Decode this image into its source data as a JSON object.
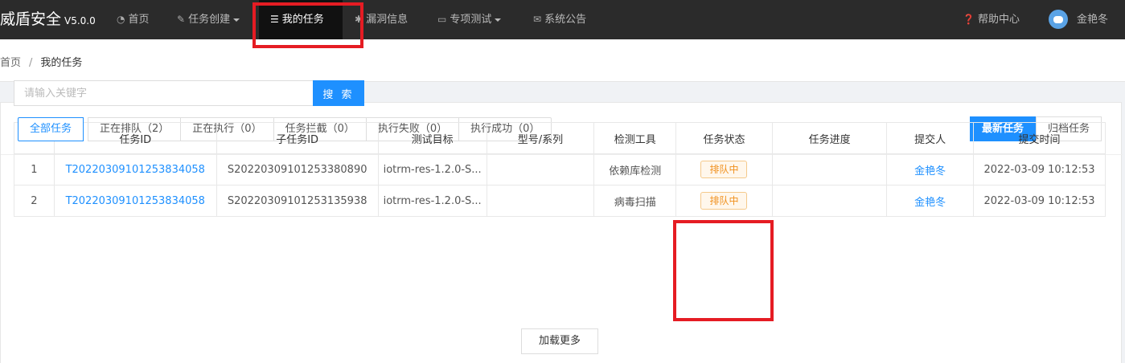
{
  "brand": {
    "name": "威盾安全",
    "version": "V5.0.0"
  },
  "nav": [
    {
      "label": "首页",
      "icon": "dashboard-icon"
    },
    {
      "label": "任务创建",
      "icon": "edit-icon",
      "dropdown": true
    },
    {
      "label": "我的任务",
      "icon": "list-icon",
      "active": true
    },
    {
      "label": "漏洞信息",
      "icon": "bug-icon"
    },
    {
      "label": "专项测试",
      "icon": "monitor-icon",
      "dropdown": true
    },
    {
      "label": "系统公告",
      "icon": "mail-icon"
    }
  ],
  "user_nav": {
    "help": "帮助中心",
    "username": "金艳冬"
  },
  "breadcrumb": {
    "home": "首页",
    "separator": "/",
    "current": "我的任务"
  },
  "status_tabs": [
    "全部任务",
    "正在排队（2）",
    "正在执行（0）",
    "任务拦截（0）",
    "执行失败（0）",
    "执行成功（0）"
  ],
  "view_tabs": [
    "最新任务",
    "归档任务"
  ],
  "search": {
    "placeholder": "请输入关键字",
    "button": "搜 索"
  },
  "table": {
    "headers": [
      "",
      "任务ID",
      "子任务ID",
      "测试目标",
      "型号/系列",
      "检测工具",
      "任务状态",
      "任务进度",
      "提交人",
      "提交时间"
    ],
    "rows": [
      {
        "index": "1",
        "task_id": "T20220309101253834058",
        "subtask_id": "S20220309101253380890",
        "target": "iotrm-res-1.2.0-S...",
        "model": "",
        "tool": "依赖库检测",
        "status": "排队中",
        "progress": "",
        "submitter": "金艳冬",
        "time": "2022-03-09 10:12:53"
      },
      {
        "index": "2",
        "task_id": "T20220309101253834058",
        "subtask_id": "S20220309101253135938",
        "target": "iotrm-res-1.2.0-S...",
        "model": "",
        "tool": "病毒扫描",
        "status": "排队中",
        "progress": "",
        "submitter": "金艳冬",
        "time": "2022-03-09 10:12:53"
      }
    ]
  },
  "load_more": "加载更多",
  "colors": {
    "accent": "#1e90ff",
    "nav_bg": "#2b2b2b",
    "highlight": "#e51c23",
    "queued": "#f0901d"
  }
}
